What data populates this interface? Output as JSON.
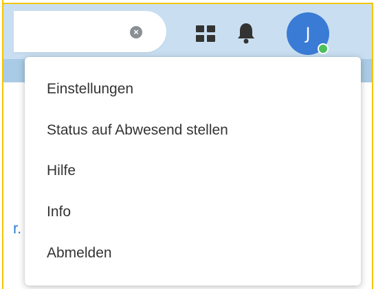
{
  "search": {
    "clear_icon": "clear-circle-icon",
    "clear_glyph": "×"
  },
  "header": {
    "apps_icon": "apps-icon",
    "notifications_icon": "bell-icon",
    "avatar_initial": "J",
    "avatar_color": "#3a7bd5",
    "presence_color": "#4cc05c"
  },
  "background": {
    "partial_link_text": "r."
  },
  "user_menu": {
    "items": [
      {
        "label": "Einstellungen"
      },
      {
        "label": "Status auf Abwesend stellen"
      },
      {
        "label": "Hilfe"
      },
      {
        "label": "Info"
      },
      {
        "label": "Abmelden"
      }
    ]
  }
}
